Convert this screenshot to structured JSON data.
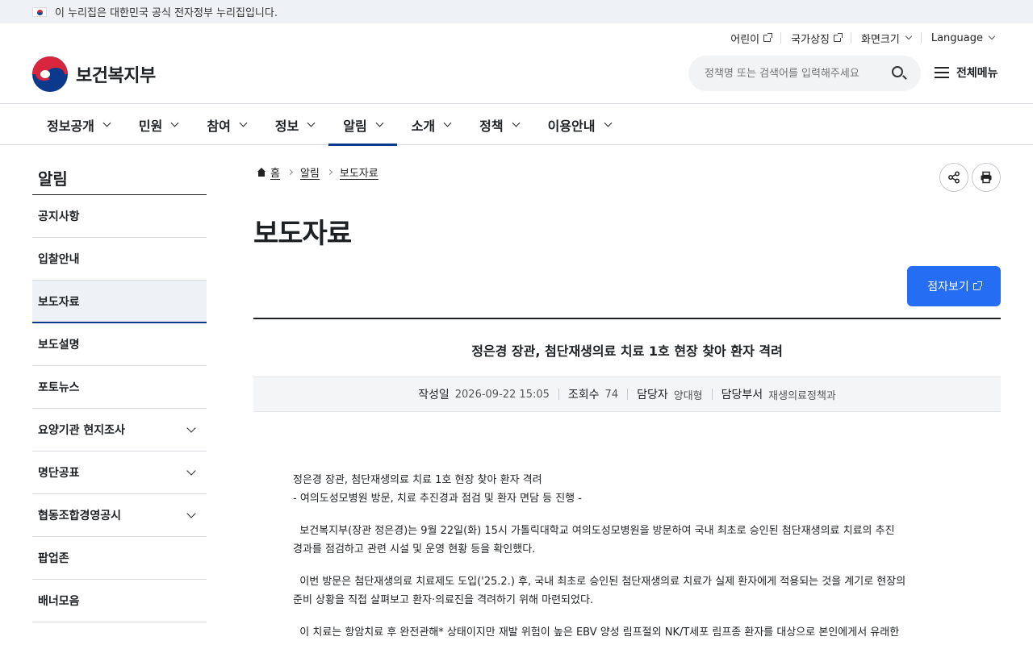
{
  "gov_banner": {
    "text": "이 누리집은 대한민국 공식 전자정부 누리집입니다."
  },
  "utility": {
    "kids": "어린이",
    "symbols": "국가상징",
    "screen_size": "화면크기",
    "language": "Language"
  },
  "logo": {
    "text": "보건복지부"
  },
  "search": {
    "placeholder": "정책명 또는 검색어를 입력해주세요"
  },
  "all_menu": "전체메뉴",
  "gnb": [
    "정보공개",
    "민원",
    "참여",
    "정보",
    "알림",
    "소개",
    "정책",
    "이용안내"
  ],
  "gnb_active": "알림",
  "lnb": {
    "title": "알림",
    "items": [
      {
        "label": "공지사항"
      },
      {
        "label": "입찰안내"
      },
      {
        "label": "보도자료"
      },
      {
        "label": "보도설명"
      },
      {
        "label": "포토뉴스"
      },
      {
        "label": "요양기관 현지조사"
      },
      {
        "label": "명단공표"
      },
      {
        "label": "협동조합경영공시"
      },
      {
        "label": "팝업존"
      },
      {
        "label": "배너모음"
      }
    ]
  },
  "breadcrumb": {
    "home": "홈",
    "level1": "알림",
    "level2": "보도자료"
  },
  "page_title": "보도자료",
  "braille_button": "점자보기",
  "article": {
    "title": "정은경 장관, 첨단재생의료 치료 1호 현장 찾아 환자 격려",
    "meta": {
      "date_label": "작성일",
      "date_value": "2026-09-22 15:05",
      "views_label": "조회수",
      "views_value": "74",
      "manager_label": "담당자",
      "manager_value": "양대형",
      "dept_label": "담당부서",
      "dept_value": "재생의료정책과"
    },
    "body": {
      "p1_line1": "정은경 장관, 첨단재생의료 치료 1호 현장 찾아 환자 격려",
      "p1_line2": "- 여의도성모병원 방문, 치료 추진경과 점검 및 환자 면담 등 진행 -",
      "p2_line1": "  보건복지부(장관 정은경)는 9월 22일(화) 15시 가톨릭대학교 여의도성모병원을 방문하여 국내 최초로 승인된 첨단재생의료 치료의 추진",
      "p2_line2": "경과를 점검하고 관련 시설 및 운영 현황 등을 확인했다.",
      "p3_line1": "  이번 방문은 첨단재생의료 치료제도 도입('25.2.) 후, 국내 최초로 승인된 첨단재생의료 치료가 실제 환자에게 적용되는 것을 계기로 현장의",
      "p3_line2": "준비 상황을 직접 살펴보고 환자·의료진을 격려하기 위해 마련되었다.",
      "p4_line1": "  이 치료는 항암치료 후 완전관해* 상태이지만 재발 위험이 높은 EBV 양성 림프절외 NK/T세포 림프종 환자를 대상으로 본인에게서 유래한"
    }
  },
  "colors": {
    "accent": "#256ef4",
    "navy": "#0b3a8c",
    "banner_bg": "#eef1f5"
  }
}
